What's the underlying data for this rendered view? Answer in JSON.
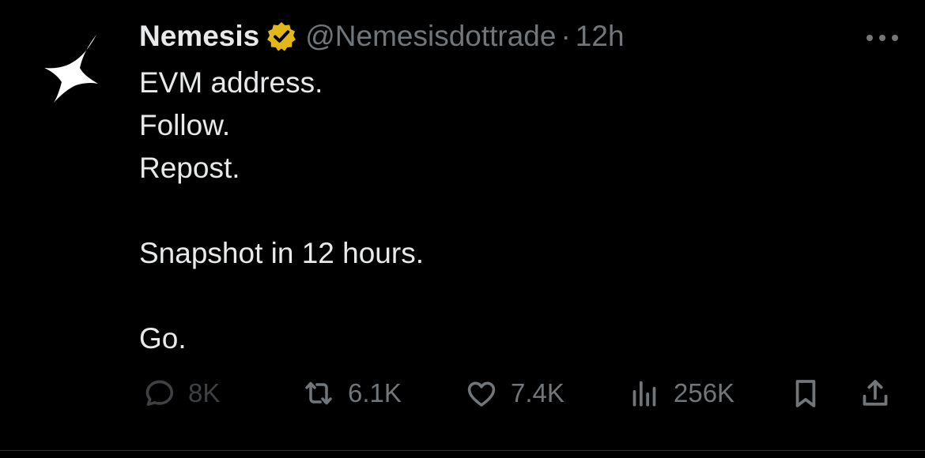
{
  "tweet": {
    "author": {
      "display_name": "Nemesis",
      "handle": "@Nemesisdottrade",
      "verified_badge": "gold-check-icon",
      "avatar": "four-point-star-logo"
    },
    "separator": "·",
    "time": "12h",
    "body_lines": [
      "EVM address.",
      "Follow.",
      "Repost.",
      "",
      "Snapshot in 12 hours.",
      "",
      "Go."
    ],
    "actions": {
      "replies": "8K",
      "reposts": "6.1K",
      "likes": "7.4K",
      "views": "256K"
    }
  },
  "colors": {
    "background": "#000000",
    "text_primary": "#e7e9ea",
    "text_secondary": "#71767b",
    "verified_gold": "#e2b719"
  }
}
